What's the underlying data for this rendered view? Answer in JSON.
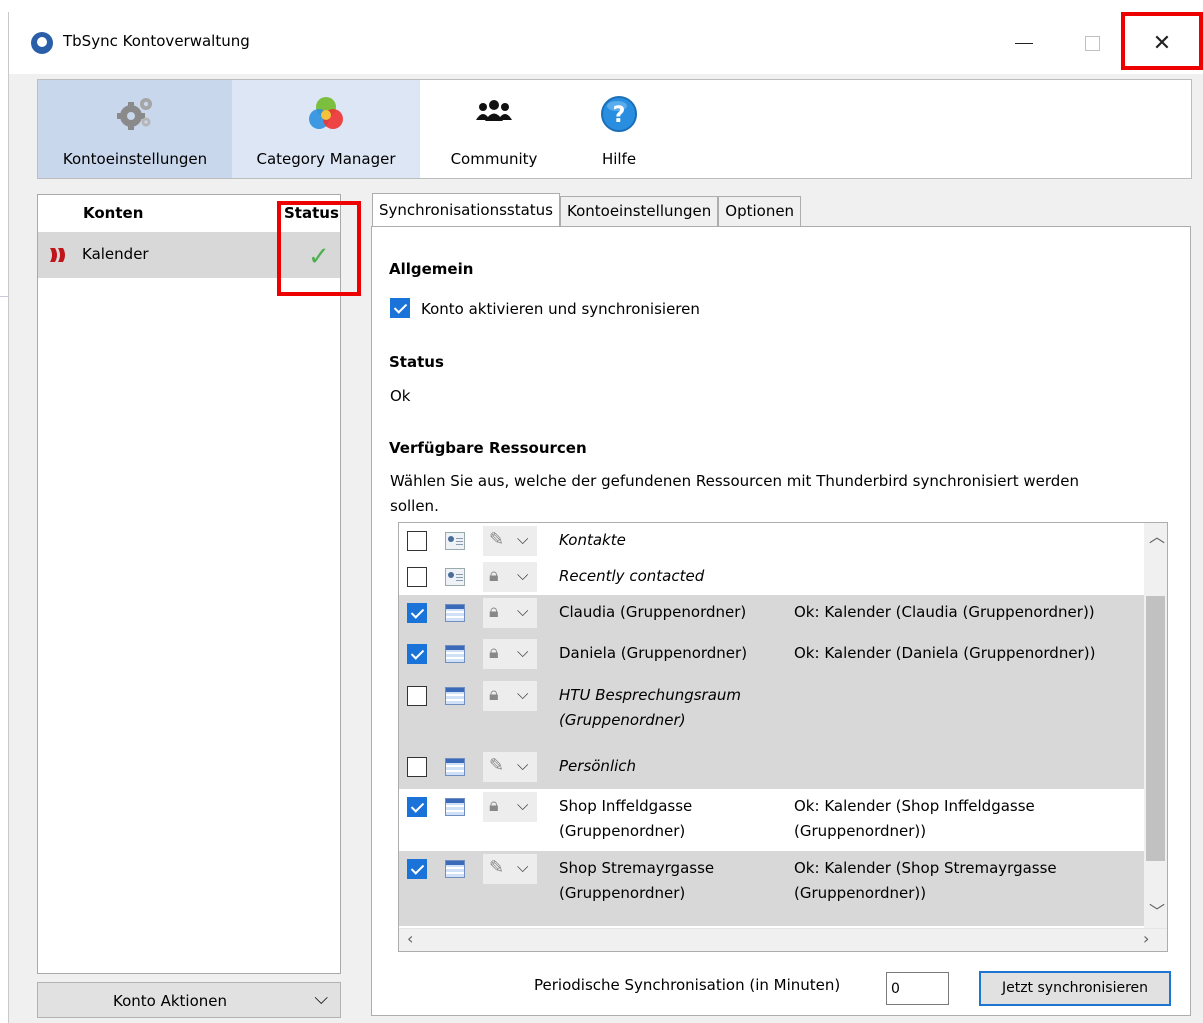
{
  "window": {
    "title": "TbSync Kontoverwaltung",
    "close_glyph": "✕"
  },
  "toolbar": {
    "items": [
      {
        "label": "Kontoeinstellungen",
        "icon": "gears-icon"
      },
      {
        "label": "Category Manager",
        "icon": "color-circles-icon"
      },
      {
        "label": "Community",
        "icon": "people-icon"
      },
      {
        "label": "Hilfe",
        "icon": "help-icon"
      }
    ]
  },
  "accounts": {
    "col_accounts": "Konten",
    "col_status": "Status",
    "rows": [
      {
        "name": "Kalender",
        "status_glyph": "✓"
      }
    ],
    "actions_label": "Konto Aktionen",
    "actions_glyph": "⌵"
  },
  "tabs": [
    "Synchronisationsstatus",
    "Kontoeinstellungen",
    "Optionen"
  ],
  "general": {
    "heading": "Allgemein",
    "enable_label": "Konto aktivieren und synchronisieren"
  },
  "status": {
    "heading": "Status",
    "value": "Ok"
  },
  "resources": {
    "heading": "Verfügbare Ressourcen",
    "description_line1": "Wählen Sie aus, welche der gefundenen Ressourcen mit Thunderbird synchronisiert werden",
    "description_line2": "sollen.",
    "rows": [
      {
        "checked": false,
        "type": "addressbook",
        "perm": "pencil",
        "name": "Kontakte",
        "name2": "",
        "italic": true,
        "status": "",
        "status2": ""
      },
      {
        "checked": false,
        "type": "addressbook",
        "perm": "lock",
        "name": "Recently contacted",
        "name2": "",
        "italic": true,
        "status": "",
        "status2": ""
      },
      {
        "checked": true,
        "type": "calendar",
        "perm": "lock",
        "name": "Claudia (Gruppenordner)",
        "name2": "",
        "italic": false,
        "status": "Ok: Kalender (Claudia (Gruppenordner))",
        "status2": ""
      },
      {
        "checked": true,
        "type": "calendar",
        "perm": "lock",
        "name": "Daniela (Gruppenordner)",
        "name2": "",
        "italic": false,
        "status": "Ok: Kalender (Daniela (Gruppenordner))",
        "status2": ""
      },
      {
        "checked": false,
        "type": "calendar",
        "perm": "lock",
        "name": "HTU Besprechungsraum",
        "name2": "(Gruppenordner)",
        "italic": true,
        "status": "",
        "status2": ""
      },
      {
        "checked": false,
        "type": "calendar",
        "perm": "pencil",
        "name": "Persönlich",
        "name2": "",
        "italic": true,
        "status": "",
        "status2": ""
      },
      {
        "checked": true,
        "type": "calendar",
        "perm": "lock",
        "name": "Shop Inffeldgasse",
        "name2": "(Gruppenordner)",
        "italic": false,
        "status": "Ok: Kalender (Shop Inffeldgasse",
        "status2": "(Gruppenordner))"
      },
      {
        "checked": true,
        "type": "calendar",
        "perm": "pencil",
        "name": "Shop Stremayrgasse",
        "name2": "(Gruppenordner)",
        "italic": false,
        "status": "Ok: Kalender (Shop Stremayrgasse",
        "status2": "(Gruppenordner))"
      }
    ]
  },
  "sync": {
    "periodic_label": "Periodische Synchronisation (in Minuten)",
    "periodic_value": "0",
    "sync_now_label": "Jetzt synchronisieren"
  }
}
